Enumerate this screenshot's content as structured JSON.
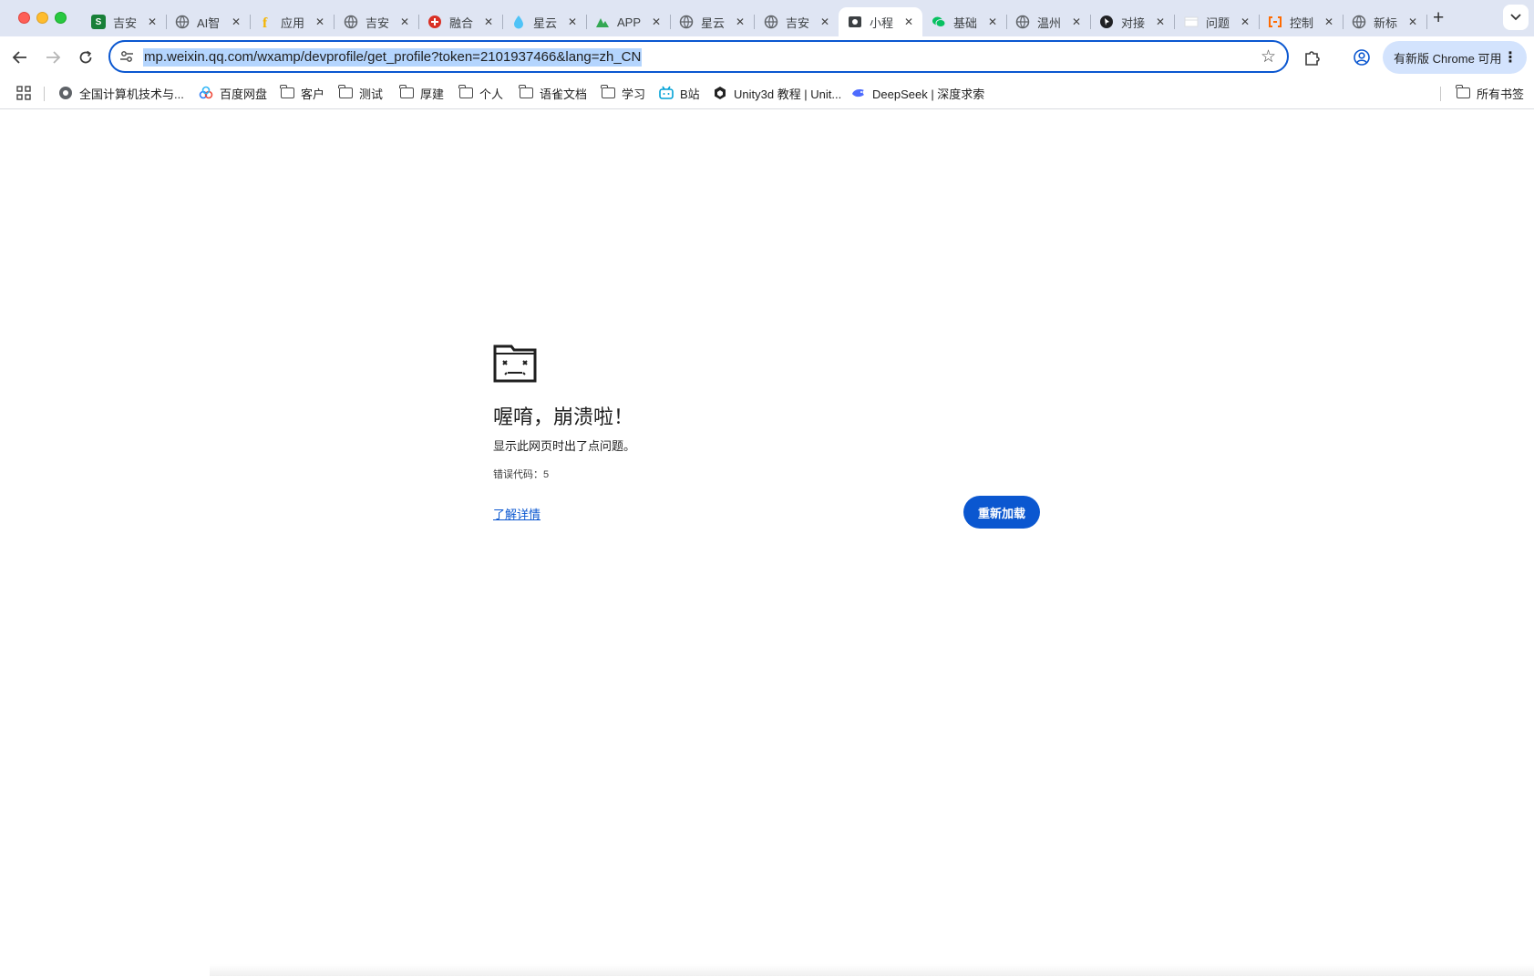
{
  "tabs": [
    {
      "title": "吉安",
      "favicon": "sheets-icon",
      "color": "#188038",
      "glyph": "S"
    },
    {
      "title": "AI智",
      "favicon": "globe-icon",
      "color": "#5f6368",
      "glyph": ""
    },
    {
      "title": "应用",
      "favicon": "f-icon",
      "color": "#f4b400",
      "glyph": "f"
    },
    {
      "title": "吉安",
      "favicon": "globe-icon",
      "color": "#5f6368",
      "glyph": ""
    },
    {
      "title": "融合",
      "favicon": "fusion-icon",
      "color": "#d93025",
      "glyph": ""
    },
    {
      "title": "星云",
      "favicon": "droplet-icon",
      "color": "#4fc3f7",
      "glyph": ""
    },
    {
      "title": "APP",
      "favicon": "mountain-icon",
      "color": "#34a853",
      "glyph": ""
    },
    {
      "title": "星云",
      "favicon": "globe-icon",
      "color": "#5f6368",
      "glyph": ""
    },
    {
      "title": "吉安",
      "favicon": "globe-icon",
      "color": "#5f6368",
      "glyph": ""
    },
    {
      "title": "小程",
      "favicon": "miniprogram-icon",
      "color": "#3c4043",
      "glyph": "",
      "active": true
    },
    {
      "title": "基础",
      "favicon": "wechat-icon",
      "color": "#07c160",
      "glyph": ""
    },
    {
      "title": "温州",
      "favicon": "globe-icon",
      "color": "#5f6368",
      "glyph": ""
    },
    {
      "title": "对接",
      "favicon": "cursor-icon",
      "color": "#202124",
      "glyph": ""
    },
    {
      "title": "问题",
      "favicon": "doc-icon",
      "color": "#dadce0",
      "glyph": ""
    },
    {
      "title": "控制",
      "favicon": "console-icon",
      "color": "#ff6a00",
      "glyph": ""
    },
    {
      "title": "新标",
      "favicon": "globe-icon",
      "color": "#5f6368",
      "glyph": ""
    }
  ],
  "toolbar": {
    "url": "mp.weixin.qq.com/wxamp/devprofile/get_profile?token=2101937466&lang=zh_CN",
    "update_label": "有新版 Chrome 可用"
  },
  "bookmarks": [
    {
      "label": "全国计算机技术与...",
      "icon": "site-icon"
    },
    {
      "label": "百度网盘",
      "icon": "baidu-pan-icon"
    },
    {
      "label": "客户",
      "icon": "folder-icon"
    },
    {
      "label": "测试",
      "icon": "folder-icon"
    },
    {
      "label": "厚建",
      "icon": "folder-icon"
    },
    {
      "label": "个人",
      "icon": "folder-icon"
    },
    {
      "label": "语雀文档",
      "icon": "folder-icon"
    },
    {
      "label": "学习",
      "icon": "folder-icon"
    },
    {
      "label": "B站",
      "icon": "bilibili-icon"
    },
    {
      "label": "Unity3d 教程 | Unit...",
      "icon": "unity-icon"
    },
    {
      "label": "DeepSeek | 深度求索",
      "icon": "deepseek-icon"
    }
  ],
  "all_bookmarks_label": "所有书签",
  "crash": {
    "title": "喔唷，崩溃啦！",
    "description": "显示此网页时出了点问题。",
    "error_code": "错误代码：5",
    "learn_more": "了解详情",
    "reload": "重新加载"
  }
}
